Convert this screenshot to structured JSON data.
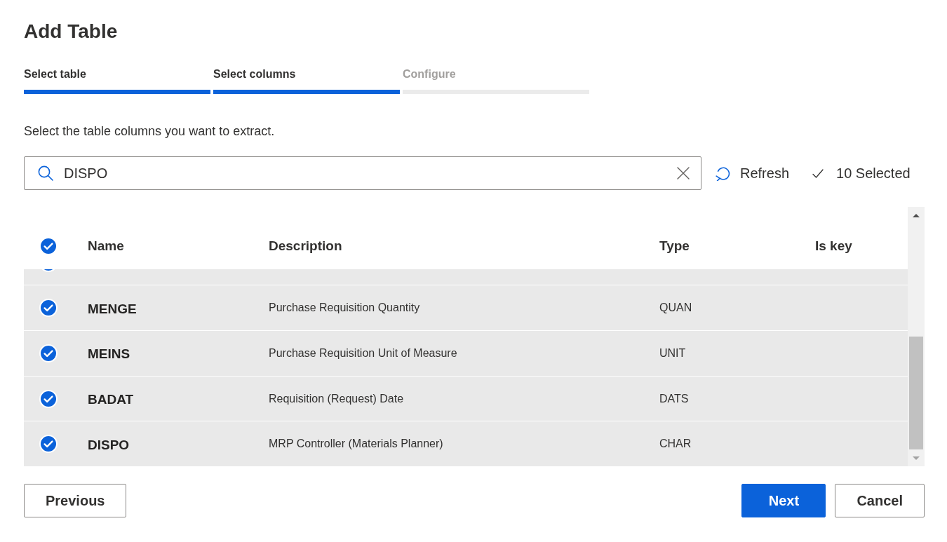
{
  "dialog": {
    "title": "Add Table"
  },
  "steps": [
    {
      "label": "Select table",
      "complete": true
    },
    {
      "label": "Select columns",
      "complete": true
    },
    {
      "label": "Configure",
      "complete": false
    }
  ],
  "instructions": "Select the table columns you want to extract.",
  "toolbar": {
    "search": {
      "value": "DISPO"
    },
    "refresh": "Refresh",
    "selection_count": "10 Selected"
  },
  "table": {
    "select_all": {
      "checked": true
    },
    "columns": [
      "Name",
      "Description",
      "Type",
      "Is key"
    ],
    "rows": [
      {
        "selected": true,
        "name": "MENGE",
        "description": "Purchase Requisition Quantity",
        "type": "QUAN"
      },
      {
        "selected": true,
        "name": "MEINS",
        "description": "Purchase Requisition Unit of Measure",
        "type": "UNIT"
      },
      {
        "selected": true,
        "name": "BADAT",
        "description": "Requisition (Request) Date",
        "type": "DATS"
      },
      {
        "selected": true,
        "name": "DISPO",
        "description": "MRP Controller (Materials Planner)",
        "type": "CHAR"
      }
    ]
  },
  "footer": {
    "left": [
      {
        "label": "Previous",
        "kind": "secondary"
      }
    ],
    "right": [
      {
        "label": "Next",
        "kind": "primary"
      },
      {
        "label": "Cancel",
        "kind": "secondary"
      }
    ]
  }
}
